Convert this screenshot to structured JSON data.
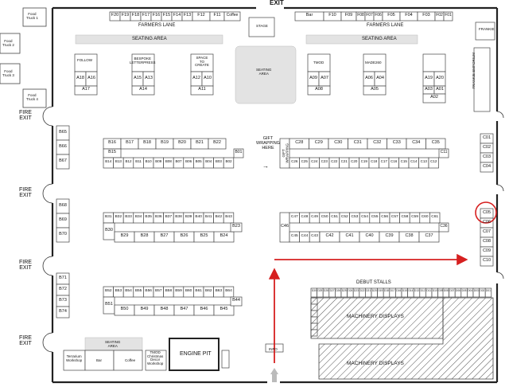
{
  "exits": {
    "top": "EXIT",
    "fire": [
      "FIRE\nEXIT",
      "FIRE\nEXIT",
      "FIRE\nEXIT",
      "FIRE\nEXIT"
    ]
  },
  "food_trucks": [
    "Food\nTruck 1",
    "Food\nTruck 2",
    "Food\nTruck 3",
    "Food\nTruck 4"
  ],
  "farmers_lane_left": {
    "stalls": [
      "F20",
      "F19",
      "F18",
      "F17",
      "F16",
      "F15",
      "F14",
      "F13",
      "F12",
      "F11"
    ],
    "coffee": "Coffee",
    "label": "FARMERS LANE"
  },
  "farmers_lane_right": {
    "bar": "Bar",
    "stalls": [
      "F10",
      "F09",
      "F08",
      "F07",
      "F06",
      "F05",
      "F04",
      "F03",
      "F02",
      "F01"
    ],
    "label": "FARMERS LANE"
  },
  "stage": "STAGE",
  "seating_area": "SEATING AREA",
  "seating_center": "SEATING\nAREA",
  "frankie": "FRANKIE",
  "frankie_emporium": "FRANKIE EMPORIUM",
  "a_zone": {
    "follow": "FOLLOW",
    "bespoke": "BESPOKE\nLETTERPRESS",
    "space": "SPACE\nTO\nCREATE",
    "tmod": "TMOD",
    "made": "MADE260",
    "stalls": [
      "A18",
      "A16",
      "A17",
      "A15",
      "A13",
      "A14",
      "A12",
      "A10",
      "A11",
      "A09",
      "A07",
      "A08",
      "A06",
      "A04",
      "A05",
      "A19",
      "A20",
      "A03",
      "A01",
      "A02"
    ]
  },
  "c_outer": [
    "C01",
    "C02",
    "C03",
    "C04",
    "C05",
    "C06",
    "C07",
    "C08",
    "C09",
    "C10"
  ],
  "b_left": [
    "B65",
    "B66",
    "B67",
    "B68",
    "B69",
    "B70",
    "B71",
    "B72",
    "B73",
    "B74"
  ],
  "b_top_row": [
    "B16",
    "B17",
    "B18",
    "B19",
    "B20",
    "B21",
    "B22"
  ],
  "b_15": "B15",
  "b_top_inner": [
    "B14",
    "B13",
    "B12",
    "B11",
    "B10",
    "B09",
    "B08",
    "B07",
    "B06",
    "B05",
    "B04",
    "B03",
    "B02"
  ],
  "b_01": "B01",
  "gift": "GIFT\nWRAPPING\nHERE",
  "gift_arrow": "→",
  "gift_rot": "GIFT\nWRAPPING",
  "c_top_row": [
    "C28",
    "C29",
    "C30",
    "C31",
    "C32",
    "C33",
    "C34",
    "C35"
  ],
  "c_top_inner": [
    "C26",
    "C25",
    "C24",
    "C23",
    "C22",
    "C21",
    "C20",
    "C19",
    "C18",
    "C17",
    "C16",
    "C15",
    "C14",
    "C13",
    "C12"
  ],
  "c_27": "C27",
  "c_11": "C11",
  "b_mid_top": [
    "B31",
    "B32",
    "B33",
    "B34",
    "B35",
    "B36",
    "B37",
    "B38",
    "B39",
    "B40",
    "B41",
    "B42",
    "B43"
  ],
  "b_mid_bottom": [
    "B29",
    "B28",
    "B27",
    "B26",
    "B25",
    "B24"
  ],
  "b_30": "B30",
  "b_23": "B23",
  "c_mid_top": [
    "C47",
    "C48",
    "C49",
    "C50",
    "C51",
    "C52",
    "C53",
    "C54",
    "C55",
    "C56",
    "C57",
    "C58",
    "C59",
    "C60",
    "C61"
  ],
  "c_mid_bottom": [
    "C45",
    "C44",
    "C43",
    "C42",
    "C41",
    "C40",
    "C39",
    "C38",
    "C37"
  ],
  "c_46": "C46",
  "c_36": "C36",
  "b_low_top": [
    "B52",
    "B53",
    "B54",
    "B55",
    "B56",
    "B57",
    "B58",
    "B59",
    "B60",
    "B61",
    "B62",
    "B63",
    "B64"
  ],
  "b_low_bottom": [
    "B50",
    "B49",
    "B48",
    "B47",
    "B46",
    "B45"
  ],
  "b_51": "B51",
  "b_44": "B44",
  "debut": "DEBUT STALLS",
  "debut_stalls": [
    "D30",
    "D29",
    "D28",
    "D27",
    "D26",
    "D25",
    "D24",
    "D23",
    "D22",
    "D21",
    "D20",
    "D19",
    "D18",
    "D17",
    "D16",
    "D15",
    "D14",
    "D13",
    "D12",
    "D11",
    "D10",
    "D09",
    "D08",
    "D07",
    "D06",
    "D05",
    "D04",
    "D03",
    "D02",
    "D01"
  ],
  "machinery": "MACHINERY DISPLAYS",
  "bottom_seating": "SEATING\nAREA",
  "terrarium": "Terrarium\nWorkshop",
  "bar": "Bar",
  "coffee": "Coffee",
  "tmod_workshop": "TMOD\nChristmas\nDecor\nWorkshop",
  "engine_pit": "ENGINE PIT",
  "info": "INFO",
  "colors": {
    "arrow": "#d62020",
    "circle": "#d62020",
    "wall": "#222222",
    "stall": "#ffffff",
    "seating": "#e2e2e2"
  }
}
